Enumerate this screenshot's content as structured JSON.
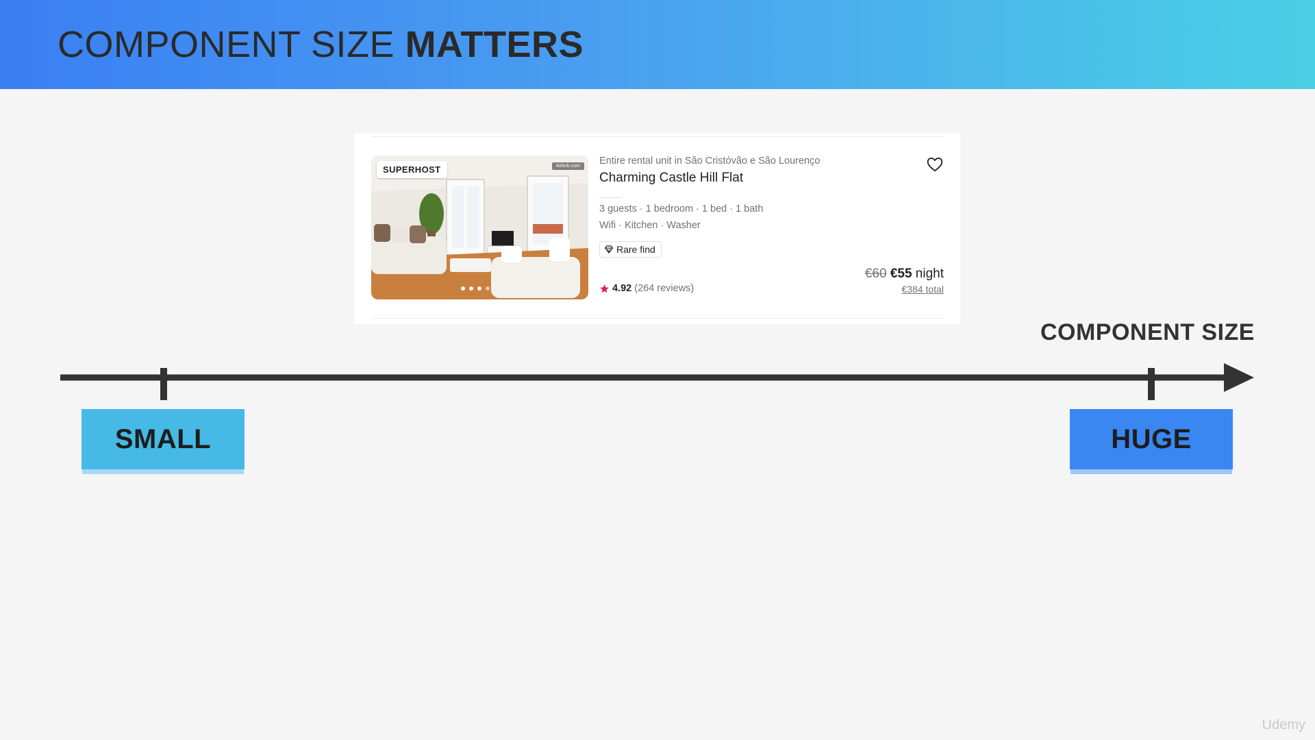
{
  "slide": {
    "title_regular": "COMPONENT SIZE",
    "title_bold": "MATTERS",
    "axis_title": "COMPONENT SIZE",
    "label_small": "SMALL",
    "label_huge": "HUGE",
    "watermark": "Udemy"
  },
  "listing": {
    "badge": "SUPERHOST",
    "photo_watermark": "Airbnb.com",
    "subtitle": "Entire rental unit in São Cristóvão e São Lourenço",
    "title": "Charming Castle Hill Flat",
    "specs": "3 guests · 1 bedroom · 1 bed · 1 bath",
    "amenities": "Wifi · Kitchen · Washer",
    "tag": "Rare find",
    "rating": "4.92",
    "reviews": "(264 reviews)",
    "old_price": "€60",
    "new_price": "€55",
    "price_unit": "night",
    "total": "€384 total",
    "photo_carousel": {
      "dots_total": 4,
      "active_dot": 1
    }
  },
  "colors": {
    "banner_start": "#3a7ff3",
    "banner_end": "#4ad0e6",
    "small_box": "#46b9e6",
    "huge_box": "#3a87f2",
    "axis": "#333333",
    "rating_star": "#e31c5f"
  },
  "icons": {
    "heart": "heart-outline-icon",
    "star": "star-icon",
    "diamond": "diamond-icon",
    "arrow": "arrow-right-icon"
  }
}
